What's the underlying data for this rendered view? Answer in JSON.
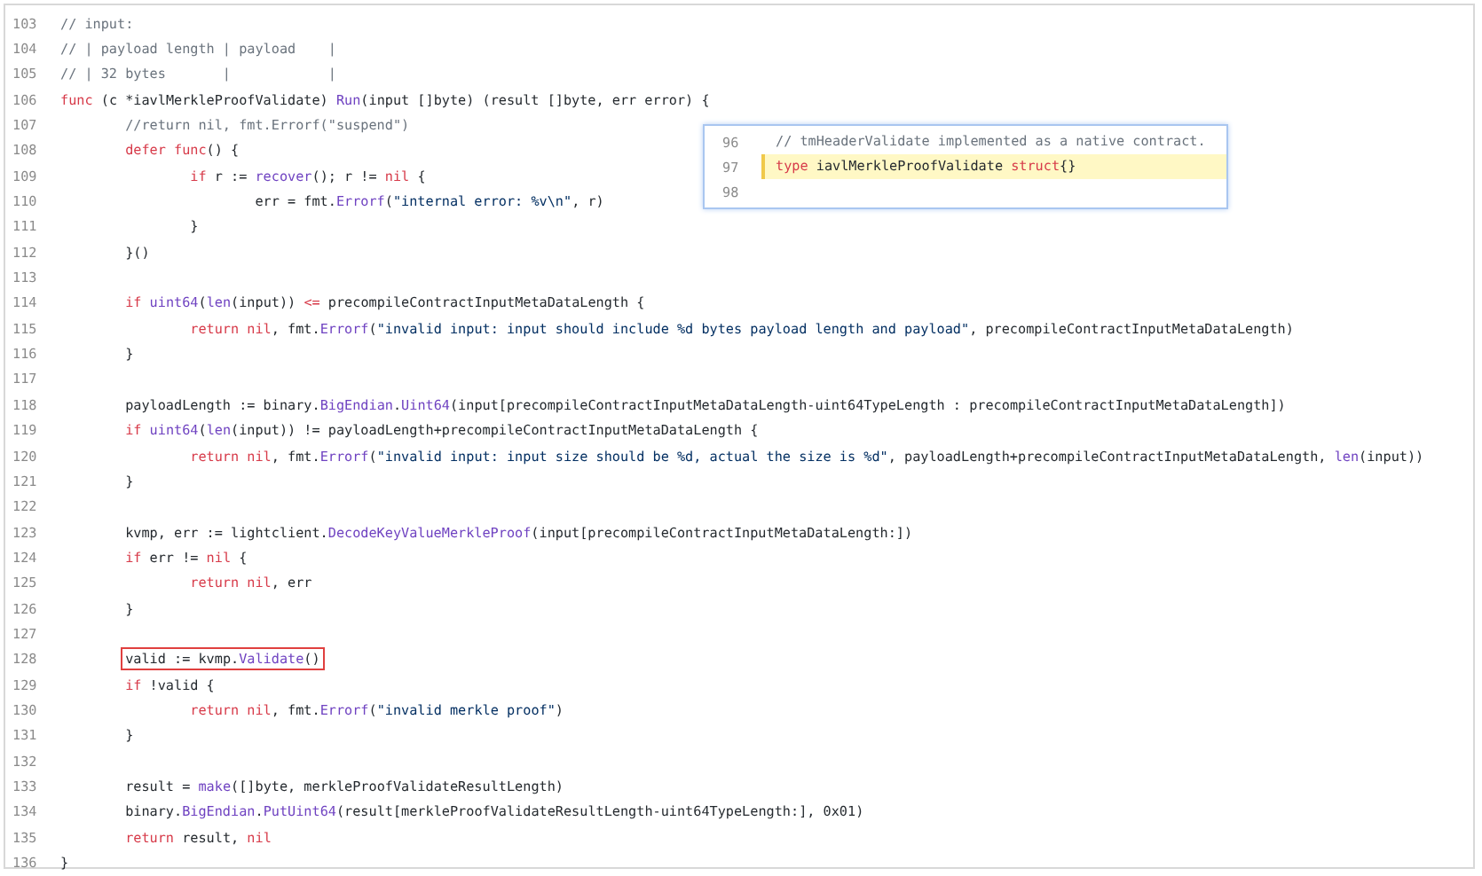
{
  "code_lines": [
    {
      "number": "103",
      "tokens": [
        {
          "text": "// input:",
          "kind": "comment"
        }
      ]
    },
    {
      "number": "104",
      "tokens": [
        {
          "text": "// | payload length | payload    |",
          "kind": "comment"
        }
      ]
    },
    {
      "number": "105",
      "tokens": [
        {
          "text": "// | 32 bytes       |            |",
          "kind": "comment"
        }
      ]
    },
    {
      "number": "106",
      "tokens": [
        {
          "text": "func",
          "kind": "keyword"
        },
        {
          "text": " (c *iavlMerkleProofValidate) ",
          "kind": "plain"
        },
        {
          "text": "Run",
          "kind": "function"
        },
        {
          "text": "(input []byte) (result []byte, err error) {",
          "kind": "plain"
        }
      ]
    },
    {
      "number": "107",
      "tokens": [
        {
          "text": "        //return nil, fmt.Errorf(\"suspend\")",
          "kind": "comment"
        }
      ]
    },
    {
      "number": "108",
      "tokens": [
        {
          "text": "        defer func",
          "kind": "keyword"
        },
        {
          "text": "() {",
          "kind": "plain"
        }
      ]
    },
    {
      "number": "109",
      "tokens": [
        {
          "text": "                if",
          "kind": "keyword"
        },
        {
          "text": " r := ",
          "kind": "plain"
        },
        {
          "text": "recover",
          "kind": "function"
        },
        {
          "text": "(); r != ",
          "kind": "plain"
        },
        {
          "text": "nil",
          "kind": "keyword"
        },
        {
          "text": " {",
          "kind": "plain"
        }
      ]
    },
    {
      "number": "110",
      "tokens": [
        {
          "text": "                        err = fmt.",
          "kind": "plain"
        },
        {
          "text": "Errorf",
          "kind": "function"
        },
        {
          "text": "(",
          "kind": "plain"
        },
        {
          "text": "\"internal error: %v\\n\"",
          "kind": "string"
        },
        {
          "text": ", r)",
          "kind": "plain"
        }
      ]
    },
    {
      "number": "111",
      "tokens": [
        {
          "text": "                }",
          "kind": "plain"
        }
      ]
    },
    {
      "number": "112",
      "tokens": [
        {
          "text": "        }()",
          "kind": "plain"
        }
      ]
    },
    {
      "number": "113"
    },
    {
      "number": "114",
      "tokens": [
        {
          "text": "        if ",
          "kind": "keyword"
        },
        {
          "text": "uint64",
          "kind": "function"
        },
        {
          "text": "(",
          "kind": "plain"
        },
        {
          "text": "len",
          "kind": "function"
        },
        {
          "text": "(input)) ",
          "kind": "plain"
        },
        {
          "text": "<=",
          "kind": "keyword"
        },
        {
          "text": " precompileContractInputMetaDataLength {",
          "kind": "plain"
        }
      ]
    },
    {
      "number": "115",
      "tokens": [
        {
          "text": "                return nil",
          "kind": "keyword"
        },
        {
          "text": ", fmt.",
          "kind": "plain"
        },
        {
          "text": "Errorf",
          "kind": "function"
        },
        {
          "text": "(",
          "kind": "plain"
        },
        {
          "text": "\"invalid input: input should include %d bytes payload length and payload\"",
          "kind": "string"
        },
        {
          "text": ", precompileContractInputMetaDataLength)",
          "kind": "plain"
        }
      ]
    },
    {
      "number": "116",
      "tokens": [
        {
          "text": "        }",
          "kind": "plain"
        }
      ]
    },
    {
      "number": "117"
    },
    {
      "number": "118",
      "tokens": [
        {
          "text": "        payloadLength := binary.",
          "kind": "plain"
        },
        {
          "text": "BigEndian",
          "kind": "function"
        },
        {
          "text": ".",
          "kind": "plain"
        },
        {
          "text": "Uint64",
          "kind": "function"
        },
        {
          "text": "(input[precompileContractInputMetaDataLength-uint64TypeLength : precompileContractInputMetaDataLength])",
          "kind": "plain"
        }
      ]
    },
    {
      "number": "119",
      "tokens": [
        {
          "text": "        if ",
          "kind": "keyword"
        },
        {
          "text": "uint64",
          "kind": "function"
        },
        {
          "text": "(",
          "kind": "plain"
        },
        {
          "text": "len",
          "kind": "function"
        },
        {
          "text": "(input)) != payloadLength+precompileContractInputMetaDataLength {",
          "kind": "plain"
        }
      ]
    },
    {
      "number": "120",
      "tokens": [
        {
          "text": "                return nil",
          "kind": "keyword"
        },
        {
          "text": ", fmt.",
          "kind": "plain"
        },
        {
          "text": "Errorf",
          "kind": "function"
        },
        {
          "text": "(",
          "kind": "plain"
        },
        {
          "text": "\"invalid input: input size should be %d, actual the size is %d\"",
          "kind": "string"
        },
        {
          "text": ", payloadLength+precompileContractInputMetaDataLength, ",
          "kind": "plain"
        },
        {
          "text": "len",
          "kind": "function"
        },
        {
          "text": "(input))",
          "kind": "plain"
        }
      ]
    },
    {
      "number": "121",
      "tokens": [
        {
          "text": "        }",
          "kind": "plain"
        }
      ]
    },
    {
      "number": "122"
    },
    {
      "number": "123",
      "tokens": [
        {
          "text": "        kvmp, err := lightclient.",
          "kind": "plain"
        },
        {
          "text": "DecodeKeyValueMerkleProof",
          "kind": "function"
        },
        {
          "text": "(input[precompileContractInputMetaDataLength:])",
          "kind": "plain"
        }
      ]
    },
    {
      "number": "124",
      "tokens": [
        {
          "text": "        if",
          "kind": "keyword"
        },
        {
          "text": " err != ",
          "kind": "plain"
        },
        {
          "text": "nil",
          "kind": "keyword"
        },
        {
          "text": " {",
          "kind": "plain"
        }
      ]
    },
    {
      "number": "125",
      "tokens": [
        {
          "text": "                return nil",
          "kind": "keyword"
        },
        {
          "text": ", err",
          "kind": "plain"
        }
      ]
    },
    {
      "number": "126",
      "tokens": [
        {
          "text": "        }",
          "kind": "plain"
        }
      ]
    },
    {
      "number": "127"
    },
    {
      "number": "128",
      "tokens": [
        {
          "text": "        valid := kvmp.",
          "kind": "plain",
          "boxed": true
        },
        {
          "text": "Validate",
          "kind": "function",
          "boxed": true
        },
        {
          "text": "()",
          "kind": "plain",
          "boxed": true
        }
      ]
    },
    {
      "number": "129",
      "tokens": [
        {
          "text": "        if",
          "kind": "keyword"
        },
        {
          "text": " !valid {",
          "kind": "plain"
        }
      ]
    },
    {
      "number": "130",
      "tokens": [
        {
          "text": "                return nil",
          "kind": "keyword"
        },
        {
          "text": ", fmt.",
          "kind": "plain"
        },
        {
          "text": "Errorf",
          "kind": "function"
        },
        {
          "text": "(",
          "kind": "plain"
        },
        {
          "text": "\"invalid merkle proof\"",
          "kind": "string"
        },
        {
          "text": ")",
          "kind": "plain"
        }
      ]
    },
    {
      "number": "131",
      "tokens": [
        {
          "text": "        }",
          "kind": "plain"
        }
      ]
    },
    {
      "number": "132"
    },
    {
      "number": "133",
      "tokens": [
        {
          "text": "        result = ",
          "kind": "plain"
        },
        {
          "text": "make",
          "kind": "function"
        },
        {
          "text": "([]byte, merkleProofValidateResultLength)",
          "kind": "plain"
        }
      ]
    },
    {
      "number": "134",
      "tokens": [
        {
          "text": "        binary.",
          "kind": "plain"
        },
        {
          "text": "BigEndian",
          "kind": "function"
        },
        {
          "text": ".",
          "kind": "plain"
        },
        {
          "text": "PutUint64",
          "kind": "function"
        },
        {
          "text": "(result[merkleProofValidateResultLength-uint64TypeLength:], 0x01)",
          "kind": "plain"
        }
      ]
    },
    {
      "number": "135",
      "tokens": [
        {
          "text": "        return",
          "kind": "keyword"
        },
        {
          "text": " result, ",
          "kind": "plain"
        },
        {
          "text": "nil",
          "kind": "keyword"
        }
      ]
    },
    {
      "number": "136",
      "tokens": [
        {
          "text": "}",
          "kind": "plain"
        }
      ]
    }
  ],
  "peek_popup": {
    "lines": [
      {
        "number": "96",
        "highlighted": false,
        "tokens": [
          {
            "text": "// tmHeaderValidate implemented as a native contract.",
            "kind": "comment"
          }
        ]
      },
      {
        "number": "97",
        "highlighted": true,
        "tokens": [
          {
            "text": "type",
            "kind": "keyword"
          },
          {
            "text": " iavlMerkleProofValidate ",
            "kind": "plain"
          },
          {
            "text": "struct",
            "kind": "keyword"
          },
          {
            "text": "{}",
            "kind": "plain"
          }
        ]
      },
      {
        "number": "98",
        "highlighted": false
      }
    ]
  }
}
